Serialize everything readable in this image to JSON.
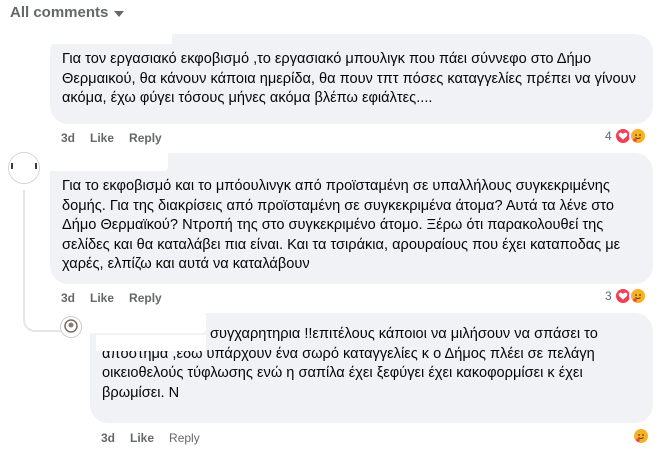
{
  "header": {
    "filter_label": "All comments",
    "caret_icon": "chevron-down-icon"
  },
  "comments": [
    {
      "text": "Για τον εργασιακό εκφοβισμό ,το εργασιακό μπουλιγκ που πάει σύννεφο στο Δήμο Θερμαικού, θα κάνουν κάποια ημερίδα, θα πουν τπτ πόσες καταγγελίες πρέπει να γίνουν ακόμα, έχω φύγει τόσους μήνες ακόμα βλέπω εφιάλτες....",
      "time": "3d",
      "like": "Like",
      "reply": "Reply",
      "reaction_count": "4",
      "reactions": [
        "heart-icon",
        "hug-emoji-icon"
      ]
    },
    {
      "text": "Για το εκφοβισμό και το μπόουλινγκ από προϊσταμένη σε υπαλλήλους συγκεκριμένης δομής. Για της διακρίσεις από προϊσταμένη σε συγκεκριμένα άτομα? Αυτά τα λένε στο Δήμο Θερμαϊκού? Ντροπή της στο συγκεκριμένο άτομο. Ξέρω ότι παρακολουθεί της σελίδες και θα καταλάβει πια είναι. Και τα τσιράκια, αρουραίους που έχει καταποδας με χαρές, ελπίζω και αυτά να καταλάβουν",
      "time": "3d",
      "like": "Like",
      "reply": "Reply",
      "reaction_count": "3",
      "reactions": [
        "heart-icon",
        "hug-emoji-icon"
      ]
    },
    {
      "text": "συγχαρητηρια !!επιτέλους κάποιοι να μιλήσουν να σπάσει το απόστημα ,εδω υπάρχουν ένα σωρό καταγγελίες κ ο Δήμος πλέει σε πελάγη οικειοθελούς τύφλωσης ενώ η σαπίλα έχει ξεφύγει έχει κακοφορμίσει κ έχει βρωμίσει. Ν",
      "time": "3d",
      "like": "Like",
      "reply": "Reply",
      "reactions": [
        "hug-emoji-icon"
      ]
    }
  ],
  "colors": {
    "bubble": "#f0f2f5",
    "meta": "#65676b",
    "heart": "#f33e58",
    "hug": "#f7b125"
  }
}
